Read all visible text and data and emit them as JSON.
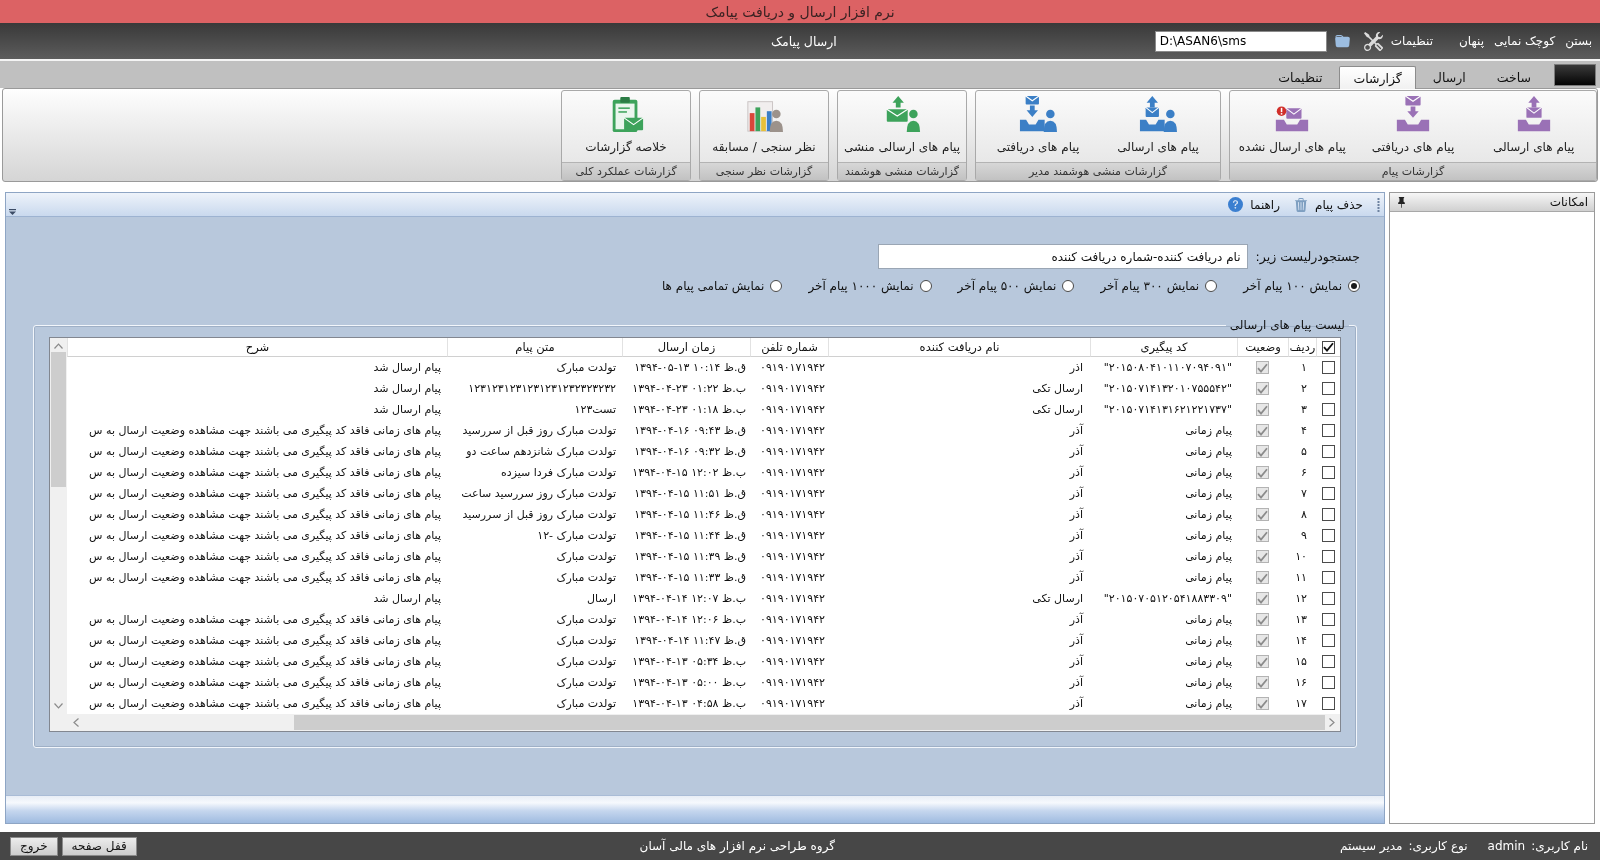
{
  "window": {
    "title": "نرم افزار ارسال و دریافت پیامک"
  },
  "top_bar": {
    "window_buttons": [
      "بستن",
      "کوچک نمایی",
      "پنهان"
    ],
    "settings_label": "تنظیمات",
    "path_value": "D:\\ASAN6\\sms",
    "page_title": "ارسال پیامک"
  },
  "tabs": [
    {
      "label": "ساخت",
      "selected": false
    },
    {
      "label": "ارسال",
      "selected": false
    },
    {
      "label": "گزارشات",
      "selected": true
    },
    {
      "label": "تنظیمات",
      "selected": false
    }
  ],
  "ribbon": [
    {
      "caption": "گزارشات پیام",
      "buttons": [
        {
          "label": "پیام های ارسالی",
          "kind": "outbox"
        },
        {
          "label": "پیام های دریافتی",
          "kind": "inbox"
        },
        {
          "label": "پیام های ارسال نشده",
          "kind": "unsent"
        }
      ]
    },
    {
      "caption": "گزارشات منشی هوشمند مدیر",
      "buttons": [
        {
          "label": "پیام های ارسالی",
          "kind": "useroutbox"
        },
        {
          "label": "پیام های دریافتی",
          "kind": "userinbox"
        }
      ]
    },
    {
      "caption": "گزارشات منشی هوشمند",
      "buttons": [
        {
          "label": "پیام های ارسالی منشی",
          "kind": "secretary"
        }
      ]
    },
    {
      "caption": "گزارشات نظر سنجی",
      "buttons": [
        {
          "label": "نظر سنجی / مسابقه",
          "kind": "poll"
        }
      ]
    },
    {
      "caption": "گزارشات عملکرد کلی",
      "buttons": [
        {
          "label": "خلاصه گزارشات",
          "kind": "summary"
        }
      ]
    }
  ],
  "toolbar": [
    {
      "label": "حذف پیام",
      "kind": "delete"
    },
    {
      "label": "راهنما",
      "kind": "help"
    }
  ],
  "search": {
    "label": "جستجودرلیست زیر:",
    "value": "نام دریافت کننده-شماره دریافت کننده"
  },
  "display_options": [
    {
      "label": "نمایش ۱۰۰ پیام آخر",
      "selected": true
    },
    {
      "label": "نمایش ۳۰۰ پیام آخر",
      "selected": false
    },
    {
      "label": "نمایش ۵۰۰ پیام آخر",
      "selected": false
    },
    {
      "label": "نمایش ۱۰۰۰ پیام آخر",
      "selected": false
    },
    {
      "label": "نمایش تمامی پیام ها",
      "selected": false
    }
  ],
  "message_list": {
    "title": "لیست پیام های ارسالی",
    "select_all": true,
    "columns": [
      "ردیف",
      "وضعیت",
      "کد پیگیری",
      "نام دریافت کننده",
      "شماره تلفن",
      "زمان ارسال",
      "متن پیام",
      "شرح"
    ],
    "rows": [
      {
        "checked": false,
        "number": "۱",
        "status": true,
        "tracking_code": "\"۲۰۱۵۰۸۰۴۱۰۱۱۰۷۰۹۴۰۹۱\"",
        "recipient": "اذر",
        "phone": "۰۹۱۹۰۱۷۱۹۴۲",
        "sent_time": "ق.ظ ۱۰:۱۴ ۱۳-۰۵-۱۳۹۴",
        "message": "تولدت مبارک",
        "description": "پیام ارسال شد"
      },
      {
        "checked": false,
        "number": "۲",
        "status": true,
        "tracking_code": "\"۲۰۱۵۰۷۱۴۱۳۲۰۱۰۷۵۵۵۴۲\"",
        "recipient": "ارسال تکی",
        "phone": "۰۹۱۹۰۱۷۱۹۴۲",
        "sent_time": "ب.ظ ۰۱:۲۲ ۲۳-۰۴-۱۳۹۴",
        "message": "۱۲۳۱۲۳۱۲۳۱۲۳۱۲۳۱۲۳۲۳۲۳۲۳۲",
        "description": "پیام ارسال شد"
      },
      {
        "checked": false,
        "number": "۳",
        "status": true,
        "tracking_code": "\"۲۰۱۵۰۷۱۴۱۳۱۶۲۱۲۲۱۷۳۷\"",
        "recipient": "ارسال تکی",
        "phone": "۰۹۱۹۰۱۷۱۹۴۲",
        "sent_time": "ب.ظ ۰۱:۱۸ ۲۳-۰۴-۱۳۹۴",
        "message": "تست۱۲۳",
        "description": "پیام ارسال شد"
      },
      {
        "checked": false,
        "number": "۴",
        "status": true,
        "tracking_code": "پیام زمانی",
        "recipient": "آذر",
        "phone": "۰۹۱۹۰۱۷۱۹۴۲",
        "sent_time": "ق.ظ ۰۹:۴۳ ۱۶-۰۴-۱۳۹۴",
        "message": "تولدت مبارک روز قبل از سررسید",
        "description": "پیام های زمانی فاقد کد پیگیری می باشند جهت مشاهده وضعیت ارسال به س"
      },
      {
        "checked": false,
        "number": "۵",
        "status": true,
        "tracking_code": "پیام زمانی",
        "recipient": "آذر",
        "phone": "۰۹۱۹۰۱۷۱۹۴۲",
        "sent_time": "ق.ظ ۰۹:۳۲ ۱۶-۰۴-۱۳۹۴",
        "message": "تولدت مبارک شانزدهم ساعت دو",
        "description": "پیام های زمانی فاقد کد پیگیری می باشند جهت مشاهده وضعیت ارسال به س"
      },
      {
        "checked": false,
        "number": "۶",
        "status": true,
        "tracking_code": "پیام زمانی",
        "recipient": "آذر",
        "phone": "۰۹۱۹۰۱۷۱۹۴۲",
        "sent_time": "ب.ظ ۱۲:۰۲ ۱۵-۰۴-۱۳۹۴",
        "message": "تولدت مبارک فردا سیزده",
        "description": "پیام های زمانی فاقد کد پیگیری می باشند جهت مشاهده وضعیت ارسال به س"
      },
      {
        "checked": false,
        "number": "۷",
        "status": true,
        "tracking_code": "پیام زمانی",
        "recipient": "آذر",
        "phone": "۰۹۱۹۰۱۷۱۹۴۲",
        "sent_time": "ق.ظ ۱۱:۵۱ ۱۵-۰۴-۱۳۹۴",
        "message": "تولدت مبارک روز سررسید ساعت",
        "description": "پیام های زمانی فاقد کد پیگیری می باشند جهت مشاهده وضعیت ارسال به س"
      },
      {
        "checked": false,
        "number": "۸",
        "status": true,
        "tracking_code": "پیام زمانی",
        "recipient": "آذر",
        "phone": "۰۹۱۹۰۱۷۱۹۴۲",
        "sent_time": "ق.ظ ۱۱:۴۶ ۱۵-۰۴-۱۳۹۴",
        "message": "تولدت مبارک روز قبل از سررسید",
        "description": "پیام های زمانی فاقد کد پیگیری می باشند جهت مشاهده وضعیت ارسال به س"
      },
      {
        "checked": false,
        "number": "۹",
        "status": true,
        "tracking_code": "پیام زمانی",
        "recipient": "آذر",
        "phone": "۰۹۱۹۰۱۷۱۹۴۲",
        "sent_time": "ق.ظ ۱۱:۴۴ ۱۵-۰۴-۱۳۹۴",
        "message": "تولدت مبارک -۱۲",
        "description": "پیام های زمانی فاقد کد پیگیری می باشند جهت مشاهده وضعیت ارسال به س"
      },
      {
        "checked": false,
        "number": "۱۰",
        "status": true,
        "tracking_code": "پیام زمانی",
        "recipient": "آذر",
        "phone": "۰۹۱۹۰۱۷۱۹۴۲",
        "sent_time": "ق.ظ ۱۱:۳۹ ۱۵-۰۴-۱۳۹۴",
        "message": "تولدت مبارک",
        "description": "پیام های زمانی فاقد کد پیگیری می باشند جهت مشاهده وضعیت ارسال به س"
      },
      {
        "checked": false,
        "number": "۱۱",
        "status": true,
        "tracking_code": "پیام زمانی",
        "recipient": "آذر",
        "phone": "۰۹۱۹۰۱۷۱۹۴۲",
        "sent_time": "ق.ظ ۱۱:۳۳ ۱۵-۰۴-۱۳۹۴",
        "message": "تولدت مبارک",
        "description": "پیام های زمانی فاقد کد پیگیری می باشند جهت مشاهده وضعیت ارسال به س"
      },
      {
        "checked": false,
        "number": "۱۲",
        "status": true,
        "tracking_code": "\"۲۰۱۵۰۷۰۵۱۲۰۵۴۱۸۸۳۳۰۹\"",
        "recipient": "ارسال تکی",
        "phone": "۰۹۱۹۰۱۷۱۹۴۲",
        "sent_time": "ب.ظ ۱۲:۰۷ ۱۴-۰۴-۱۳۹۴",
        "message": "ارسال",
        "description": "پیام ارسال شد"
      },
      {
        "checked": false,
        "number": "۱۳",
        "status": true,
        "tracking_code": "پیام زمانی",
        "recipient": "آذر",
        "phone": "۰۹۱۹۰۱۷۱۹۴۲",
        "sent_time": "ب.ظ ۱۲:۰۶ ۱۴-۰۴-۱۳۹۴",
        "message": "تولدت مبارک",
        "description": "پیام های زمانی فاقد کد پیگیری می باشند جهت مشاهده وضعیت ارسال به س"
      },
      {
        "checked": false,
        "number": "۱۴",
        "status": true,
        "tracking_code": "پیام زمانی",
        "recipient": "آذر",
        "phone": "۰۹۱۹۰۱۷۱۹۴۲",
        "sent_time": "ق.ظ ۱۱:۴۷ ۱۴-۰۴-۱۳۹۴",
        "message": "تولدت مبارک",
        "description": "پیام های زمانی فاقد کد پیگیری می باشند جهت مشاهده وضعیت ارسال به س"
      },
      {
        "checked": false,
        "number": "۱۵",
        "status": true,
        "tracking_code": "پیام زمانی",
        "recipient": "آذر",
        "phone": "۰۹۱۹۰۱۷۱۹۴۲",
        "sent_time": "ب.ظ ۰۵:۳۴ ۱۳-۰۴-۱۳۹۴",
        "message": "تولدت مبارک",
        "description": "پیام های زمانی فاقد کد پیگیری می باشند جهت مشاهده وضعیت ارسال به س"
      },
      {
        "checked": false,
        "number": "۱۶",
        "status": true,
        "tracking_code": "پیام زمانی",
        "recipient": "آذر",
        "phone": "۰۹۱۹۰۱۷۱۹۴۲",
        "sent_time": "ب.ظ ۰۵:۰۰ ۱۳-۰۴-۱۳۹۴",
        "message": "تولدت مبارک",
        "description": "پیام های زمانی فاقد کد پیگیری می باشند جهت مشاهده وضعیت ارسال به س"
      },
      {
        "checked": false,
        "number": "۱۷",
        "status": true,
        "tracking_code": "پیام زمانی",
        "recipient": "آذر",
        "phone": "۰۹۱۹۰۱۷۱۹۴۲",
        "sent_time": "ب.ظ ۰۴:۵۸ ۱۳-۰۴-۱۳۹۴",
        "message": "تولدت مبارک",
        "description": "پیام های زمانی فاقد کد پیگیری می باشند جهت مشاهده وضعیت ارسال به س"
      }
    ]
  },
  "side_panel": {
    "title": "امکانات"
  },
  "status_bar": {
    "user_label": "نام کاربری:",
    "user": "admin",
    "type_label": "نوع کاربری:",
    "type": "مدیر سیستم",
    "credit": "گروه طراحی نرم افزار های مالی آسان",
    "buttons": [
      "قفل صفحه",
      "خروج"
    ]
  }
}
